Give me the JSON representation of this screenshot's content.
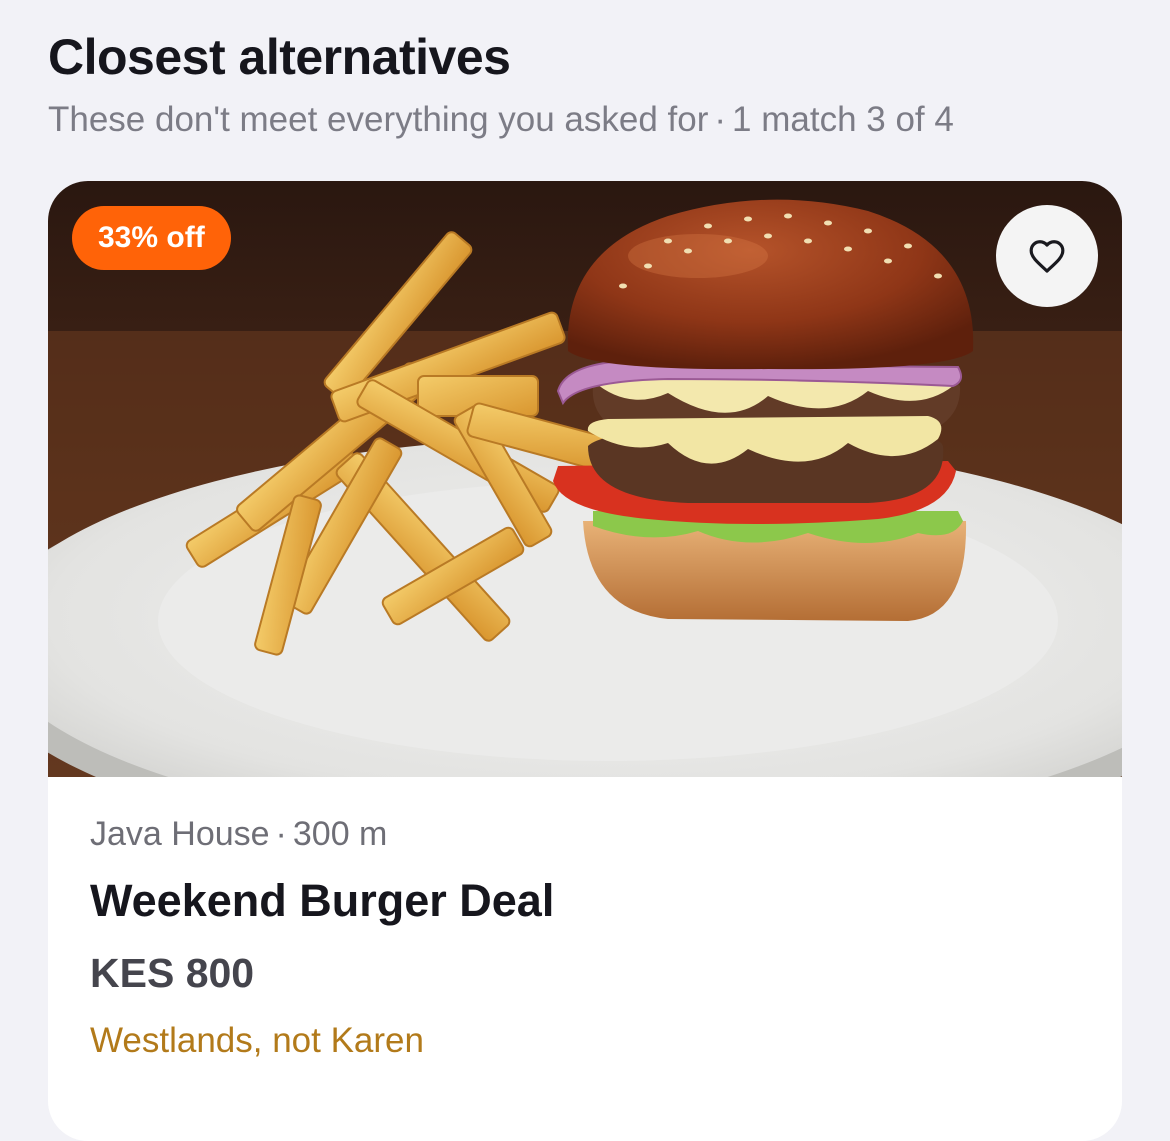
{
  "section": {
    "title": "Closest alternatives",
    "subtitle_reason": "These don't meet everything you asked for",
    "separator": "·",
    "subtitle_count": "1 match 3 of 4"
  },
  "deal": {
    "badge": "33% off",
    "merchant": "Java House",
    "separator": "·",
    "distance": "300 m",
    "title": "Weekend Burger Deal",
    "price": "KES 800",
    "location_note": "Westlands, not Karen",
    "favorite_icon": "heart-icon",
    "image_subject": "burger-with-fries-photo"
  },
  "colors": {
    "badge_bg": "#ff6308",
    "location_note": "#b27a1a",
    "background": "#f2f2f7"
  }
}
